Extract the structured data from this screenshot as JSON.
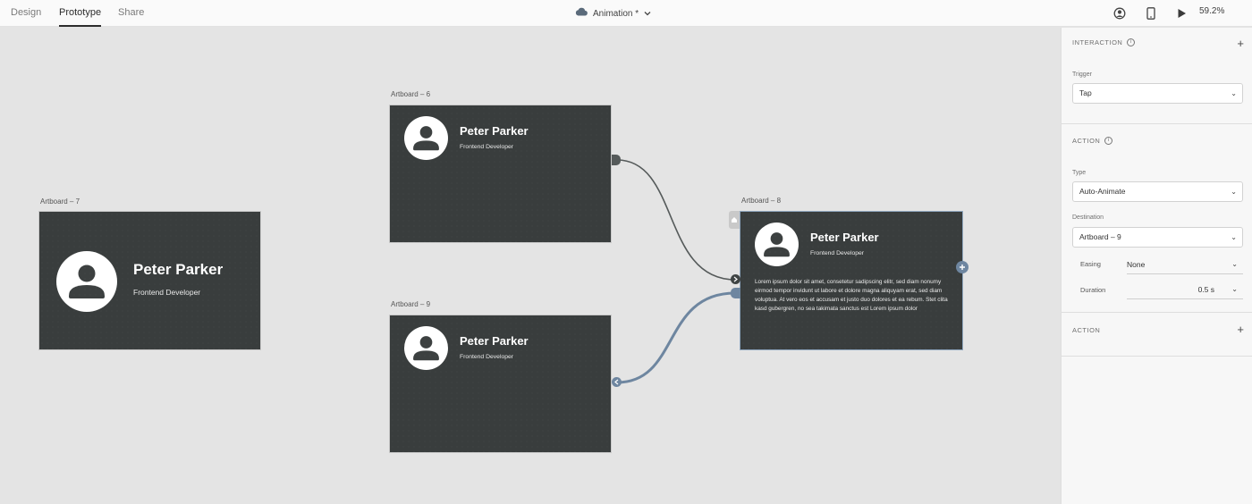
{
  "tabs": [
    {
      "label": "Design",
      "active": false
    },
    {
      "label": "Prototype",
      "active": true
    },
    {
      "label": "Share",
      "active": false
    }
  ],
  "document": {
    "title": "Animation *",
    "icon": "cloud-icon"
  },
  "toolbar": {
    "zoom": "59.2%",
    "icons": [
      "user-circle-icon",
      "device-preview-icon",
      "play-icon"
    ]
  },
  "artboards": [
    {
      "id": "artboard-7",
      "label": "Artboard – 7",
      "name": "Peter Parker",
      "role": "Frontend Developer"
    },
    {
      "id": "artboard-6",
      "label": "Artboard – 6",
      "name": "Peter Parker",
      "role": "Frontend Developer"
    },
    {
      "id": "artboard-9",
      "label": "Artboard – 9",
      "name": "Peter Parker",
      "role": "Frontend Developer"
    },
    {
      "id": "artboard-8",
      "label": "Artboard – 8",
      "name": "Peter Parker",
      "role": "Frontend Developer",
      "body": "Lorem ipsum dolor sit amet, consetetur sadipscing elitr, sed diam nonumy eirmod tempor invidunt ut labore et dolore magna aliquyam erat, sed diam voluptua. At vero eos et accusam et justo duo dolores et ea rebum. Stet clita kasd gubergren, no sea takimata sanctus est Lorem ipsum dolor",
      "home": true
    }
  ],
  "panel": {
    "interaction": {
      "title": "INTERACTION",
      "trigger_label": "Trigger",
      "trigger_value": "Tap"
    },
    "action": {
      "title": "ACTION",
      "type_label": "Type",
      "type_value": "Auto-Animate",
      "destination_label": "Destination",
      "destination_value": "Artboard – 9",
      "easing_label": "Easing",
      "easing_value": "None",
      "duration_label": "Duration",
      "duration_value": "0.5 s"
    },
    "action2": {
      "title": "ACTION"
    }
  },
  "colors": {
    "artboard": "#393d3d",
    "wire_selected": "#6e86a0",
    "wire": "#555a5a",
    "canvas": "#e4e4e4"
  }
}
